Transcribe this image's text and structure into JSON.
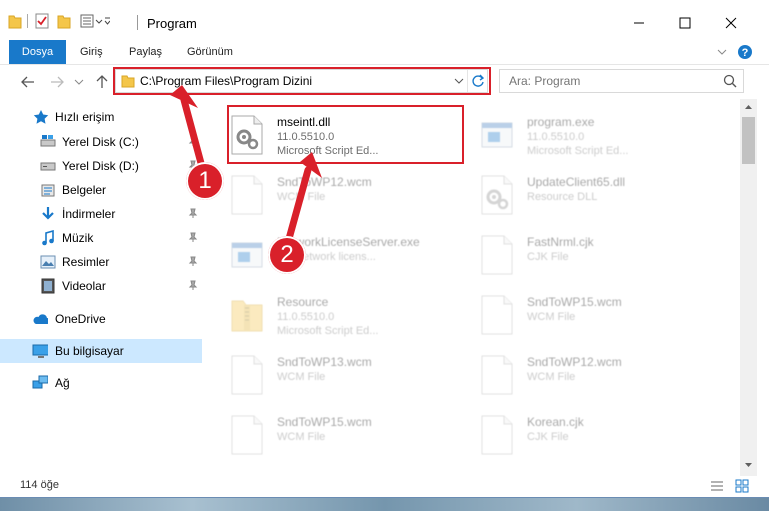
{
  "window": {
    "title": "Program",
    "minimize_glyph": "—",
    "maximize_glyph": "☐",
    "close_glyph": "✕"
  },
  "ribbon": {
    "tabs": [
      {
        "label": "Dosya"
      },
      {
        "label": "Giriş"
      },
      {
        "label": "Paylaş"
      },
      {
        "label": "Görünüm"
      }
    ]
  },
  "address": {
    "path": "C:\\Program Files\\Program Dizini"
  },
  "search": {
    "placeholder": "Ara: Program"
  },
  "sidebar": {
    "items": [
      {
        "label": "Hızlı erişim",
        "icon": "star-icon"
      },
      {
        "label": "Yerel Disk (C:)",
        "icon": "drive-icon",
        "pinned": true
      },
      {
        "label": "Yerel Disk (D:)",
        "icon": "drive-icon",
        "pinned": true
      },
      {
        "label": "Belgeler",
        "icon": "documents-icon",
        "pinned": true
      },
      {
        "label": "İndirmeler",
        "icon": "download-icon",
        "pinned": true
      },
      {
        "label": "Müzik",
        "icon": "music-icon",
        "pinned": true
      },
      {
        "label": "Resimler",
        "icon": "pictures-icon",
        "pinned": true
      },
      {
        "label": "Videolar",
        "icon": "videos-icon",
        "pinned": true
      },
      {
        "label": "OneDrive",
        "icon": "cloud-icon"
      },
      {
        "label": "Bu bilgisayar",
        "icon": "computer-icon",
        "selected": true
      },
      {
        "label": "Ağ",
        "icon": "network-icon"
      }
    ]
  },
  "files": [
    {
      "name": "mseintl.dll",
      "line1": "11.0.5510.0",
      "line2": "Microsoft Script Ed...",
      "icon": "gear-file-icon",
      "highlighted": true
    },
    {
      "name": "program.exe",
      "line1": "11.0.5510.0",
      "line2": "Microsoft Script Ed...",
      "icon": "exe-icon"
    },
    {
      "name": "SndToWP12.wcm",
      "line1": "WCM File",
      "line2": "",
      "icon": "blank-file-icon"
    },
    {
      "name": "UpdateClient65.dll",
      "line1": "Resource DLL",
      "line2": "",
      "icon": "gear-file-icon"
    },
    {
      "name": "NetworkLicenseServer.exe",
      "line1": "ITY network licens...",
      "line2": "",
      "icon": "exe-icon"
    },
    {
      "name": "FastNrml.cjk",
      "line1": "CJK File",
      "line2": "",
      "icon": "blank-file-icon"
    },
    {
      "name": "Resource",
      "line1": "11.0.5510.0",
      "line2": "Microsoft Script Ed...",
      "icon": "archive-icon"
    },
    {
      "name": "SndToWP15.wcm",
      "line1": "WCM File",
      "line2": "",
      "icon": "blank-file-icon"
    },
    {
      "name": "SndToWP13.wcm",
      "line1": "WCM File",
      "line2": "",
      "icon": "blank-file-icon"
    },
    {
      "name": "SndToWP12.wcm",
      "line1": "WCM File",
      "line2": "",
      "icon": "blank-file-icon"
    },
    {
      "name": "SndToWP15.wcm",
      "line1": "WCM File",
      "line2": "",
      "icon": "blank-file-icon"
    },
    {
      "name": "Korean.cjk",
      "line1": "CJK File",
      "line2": "",
      "icon": "blank-file-icon"
    }
  ],
  "status": {
    "count": "114 öğe"
  },
  "annotations": {
    "step1": "1",
    "step2": "2",
    "color": "#d9202a"
  }
}
